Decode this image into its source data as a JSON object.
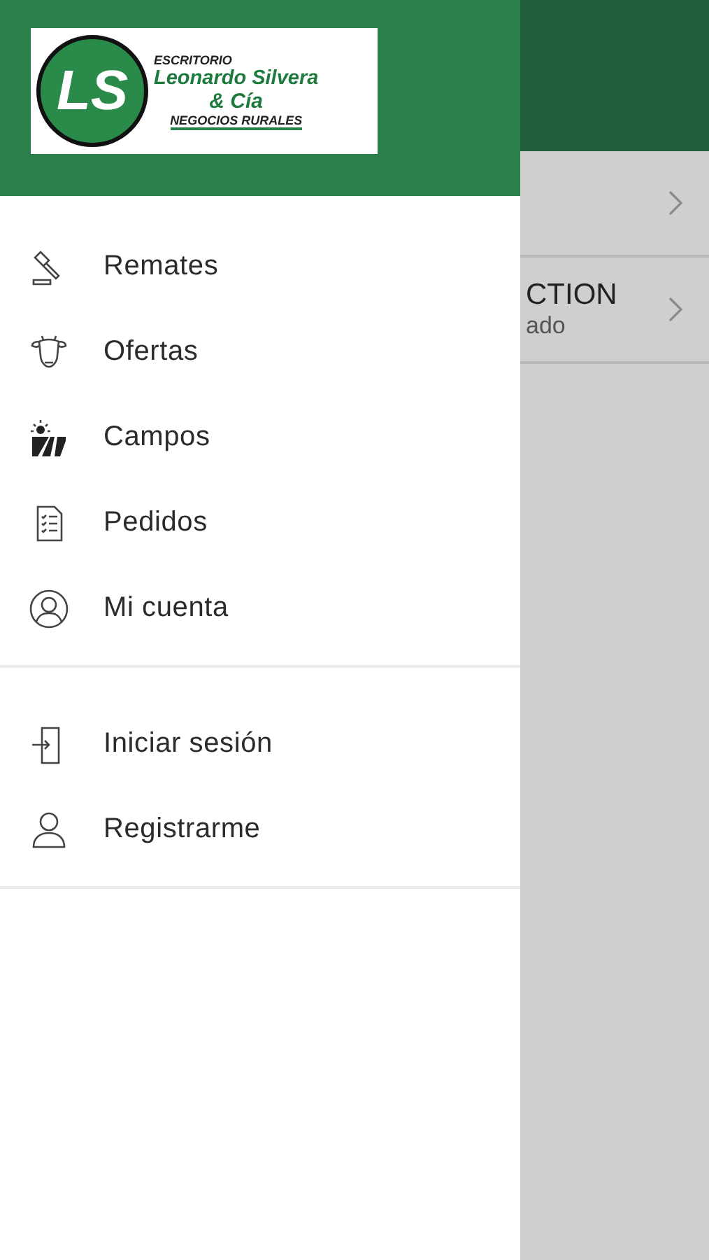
{
  "background": {
    "rows": [
      {
        "title": "",
        "subtitle": ""
      },
      {
        "title": "CTION",
        "subtitle": "ado"
      }
    ]
  },
  "drawer": {
    "logo": {
      "monogram": "LS",
      "top": "ESCRITORIO",
      "name": "Leonardo Silvera",
      "name2": "& Cía",
      "tagline": "NEGOCIOS RURALES"
    },
    "sections": [
      [
        {
          "label": "Remates"
        },
        {
          "label": "Ofertas"
        },
        {
          "label": "Campos"
        },
        {
          "label": "Pedidos"
        },
        {
          "label": "Mi cuenta"
        }
      ],
      [
        {
          "label": "Iniciar sesión"
        },
        {
          "label": "Registrarme"
        }
      ]
    ]
  }
}
